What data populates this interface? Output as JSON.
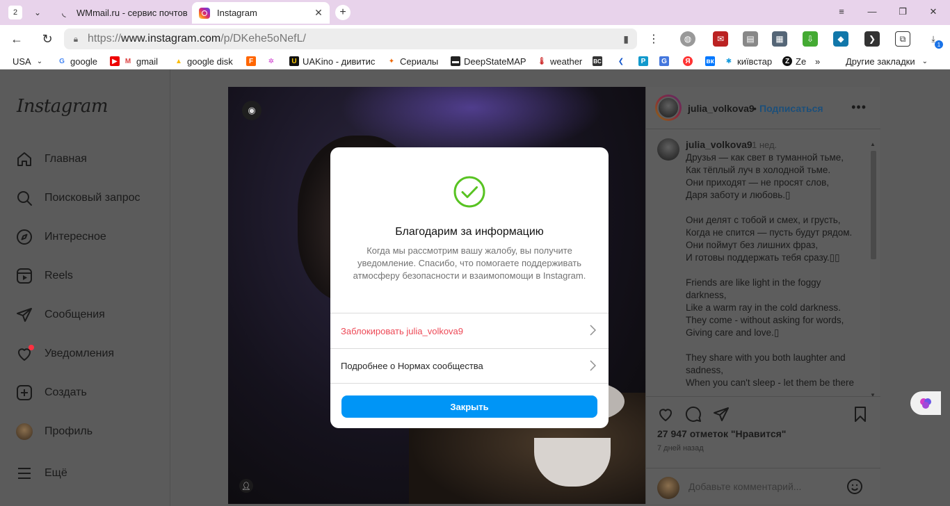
{
  "browser": {
    "tab_count": "2",
    "tabs": [
      {
        "title": "WMmail.ru - сервис почтовых"
      },
      {
        "title": "Instagram"
      }
    ],
    "url_prefix": "https://",
    "url_domain": "www.instagram.com",
    "url_path": "/p/DKehe5oNefL/",
    "extension_badge": "1",
    "bookmarks": [
      {
        "label": "USA"
      },
      {
        "label": "google"
      },
      {
        "label": "gmail"
      },
      {
        "label": "google disk"
      },
      {
        "label": "UAKino - дивитис"
      },
      {
        "label": "Сериалы"
      },
      {
        "label": "DeepStateMAP"
      },
      {
        "label": "weather"
      },
      {
        "label": "київстар"
      },
      {
        "label": "Ze"
      },
      {
        "label": "Другие закладки"
      }
    ]
  },
  "sidebar": {
    "logo": "Instagram",
    "items": [
      {
        "label": "Главная",
        "icon": "home-icon"
      },
      {
        "label": "Поисковый запрос",
        "icon": "search-icon"
      },
      {
        "label": "Интересное",
        "icon": "compass-icon"
      },
      {
        "label": "Reels",
        "icon": "reels-icon"
      },
      {
        "label": "Сообщения",
        "icon": "messages-icon"
      },
      {
        "label": "Уведомления",
        "icon": "heart-icon"
      },
      {
        "label": "Создать",
        "icon": "plus-square-icon"
      },
      {
        "label": "Профиль",
        "icon": "avatar"
      },
      {
        "label": "Ещё",
        "icon": "menu-icon"
      }
    ]
  },
  "post": {
    "username": "julia_volkova9",
    "dot": "•",
    "follow": "Подписаться",
    "caption_time": "1 нед.",
    "caption": "Друзья — как свет в туманной тьме,\nКак тёплый луч в холодной тьме.\nОни приходят — не просят слов,\nДаря заботу и любовь.▯\n\nОни делят с тобой и смех, и грусть,\nКогда не спится — пусть будут рядом.\nОни поймут без лишних фраз,\nИ готовы поддержать тебя сразу.▯▯\n\nFriends are like light in the foggy darkness,\nLike a warm ray in the cold darkness.\nThey come - without asking for words,\nGiving care and love.▯\n\nThey share with you both laughter and sadness,\nWhen you can't sleep - let them be there",
    "likes": "27 947 отметок \"Нравится\"",
    "posted_ago": "7 дней назад",
    "comment_placeholder": "Добавьте комментарий..."
  },
  "modal": {
    "title": "Благодарим за информацию",
    "body": "Когда мы рассмотрим вашу жалобу, вы получите уведомление. Спасибо, что помогаете поддерживать атмосферу безопасности и взаимопомощи в Instagram.",
    "block_label": "Заблокировать julia_volkova9",
    "rules_label": "Подробнее о Нормах сообщества",
    "close_label": "Закрыть"
  },
  "colors": {
    "accent_blue": "#0095f6",
    "danger_red": "#ed4956",
    "success_green": "#58c322",
    "overlay_bg": "#5b5b5b"
  }
}
